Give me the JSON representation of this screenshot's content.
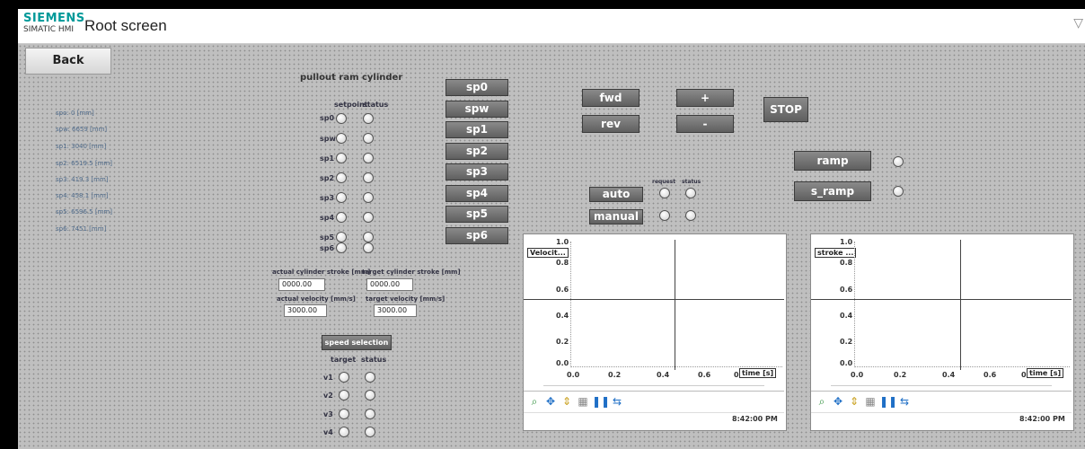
{
  "header": {
    "brand": "SIEMENS",
    "product": "SIMATIC HMI",
    "title": "Root screen"
  },
  "nav": {
    "back_label": "Back"
  },
  "cylinder": {
    "title": "pullout ram cylinder",
    "col_setpoint": "setpoint",
    "col_status": "status",
    "info_labels": [
      "spo: 0 [mm]",
      "spw: 6659 [mm]",
      "sp1: 3040 [mm]",
      "sp2: 6519.5 [mm]",
      "sp3: 419.3 [mm]",
      "sp4: 458.1 [mm]",
      "sp5: 6596.5 [mm]",
      "sp6: 7451 [mm]"
    ],
    "row_labels": [
      "sp0",
      "spw",
      "sp1",
      "sp2",
      "sp3",
      "sp4",
      "sp5",
      "sp6"
    ],
    "actual_stroke_label": "actual cylinder stroke [mm]",
    "target_stroke_label": "target cylinder stroke [mm]",
    "actual_stroke": "0000.00",
    "target_stroke": "0000.00",
    "actual_velocity_label": "actual velocity [mm/s]",
    "target_velocity_label": "target velocity [mm/s]",
    "actual_velocity": "3000.00",
    "target_velocity": "3000.00"
  },
  "speed": {
    "button": "speed selection",
    "col_target": "target",
    "col_status": "status",
    "rows": [
      "v1",
      "v2",
      "v3",
      "v4"
    ]
  },
  "setpoint_buttons": [
    "sp0",
    "spw",
    "sp1",
    "sp2",
    "sp3",
    "sp4",
    "sp5",
    "sp6"
  ],
  "motion": {
    "fwd": "fwd",
    "rev": "rev",
    "plus": "+",
    "minus": "-",
    "stop": "STOP"
  },
  "mode": {
    "col_request": "request",
    "col_status": "status",
    "auto": "auto",
    "manual": "manual"
  },
  "ramps": {
    "ramp": "ramp",
    "s_ramp": "s_ramp"
  },
  "trends": [
    {
      "tag": "Velocit...",
      "y_ticks": [
        "1.0",
        "0.8",
        "0.6",
        "0.4",
        "0.2",
        "0.0"
      ],
      "x_ticks": [
        "0.0",
        "0.2",
        "0.4",
        "0.6",
        "0."
      ],
      "x_label": "time [s]",
      "time": "8:42:00 PM"
    },
    {
      "tag": "stroke ...",
      "y_ticks": [
        "1.0",
        "0.8",
        "0.6",
        "0.4",
        "0.2",
        "0.0"
      ],
      "x_ticks": [
        "0.0",
        "0.2",
        "0.4",
        "0.6",
        "0."
      ],
      "x_label": "time [s]",
      "time": "8:42:00 PM"
    }
  ],
  "icons": [
    "zoom-icon",
    "move-icon",
    "ruler-icon",
    "table-icon",
    "pause-icon",
    "ruler-move-icon",
    "clock-icon"
  ]
}
